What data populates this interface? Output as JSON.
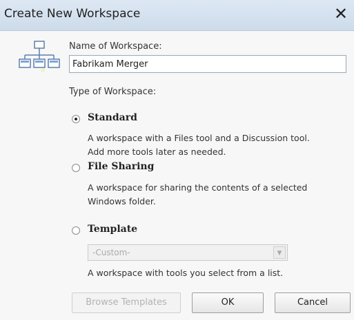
{
  "window": {
    "title": "Create New Workspace",
    "close_glyph": "✕"
  },
  "icons": {
    "app_icon": "workspace-hierarchy-icon",
    "dropdown": "chevron-down-icon"
  },
  "form": {
    "name_label": "Name of Workspace:",
    "name_value": "Fabrikam Merger",
    "type_label": "Type of Workspace:"
  },
  "options": [
    {
      "title": "Standard",
      "checked": true,
      "description_lines": [
        "A workspace with a Files tool and a Discussion tool.",
        "Add more tools later as needed."
      ]
    },
    {
      "title": "File Sharing",
      "checked": false,
      "description_lines": [
        "A workspace for sharing the contents of a selected",
        "Windows folder."
      ]
    },
    {
      "title": "Template",
      "checked": false,
      "select_value": "-Custom-",
      "description_lines": [
        "A workspace with tools you select from a list."
      ]
    }
  ],
  "buttons": {
    "browse": "Browse Templates",
    "ok": "OK",
    "cancel": "Cancel"
  }
}
